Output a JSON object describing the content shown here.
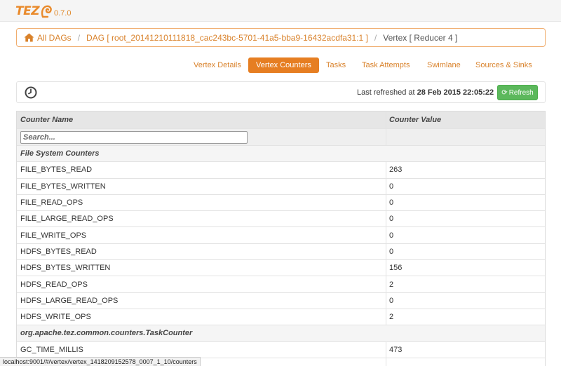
{
  "app": {
    "logo_text": "TEZ",
    "version": "0.7.0"
  },
  "breadcrumb": {
    "all_dags": "All DAGs",
    "dag": "DAG [ root_20141210111818_cac243bc-5701-41a5-bba9-16432acdfa31:1 ]",
    "current": "Vertex [ Reducer 4 ]"
  },
  "tabs": [
    {
      "label": "Vertex Details",
      "active": false
    },
    {
      "label": "Vertex Counters",
      "active": true
    },
    {
      "label": "Tasks",
      "active": false
    },
    {
      "label": "Task Attempts",
      "active": false
    },
    {
      "label": "Swimlane",
      "active": false
    },
    {
      "label": "Sources & Sinks",
      "active": false
    }
  ],
  "refresh": {
    "prefix": "Last refreshed at",
    "timestamp": "28 Feb 2015 22:05:22",
    "button_label": "Refresh"
  },
  "table": {
    "col_name": "Counter Name",
    "col_value": "Counter Value",
    "search_placeholder": "Search...",
    "groups": [
      {
        "name": "File System Counters",
        "rows": [
          {
            "name": "FILE_BYTES_READ",
            "value": "263"
          },
          {
            "name": "FILE_BYTES_WRITTEN",
            "value": "0"
          },
          {
            "name": "FILE_READ_OPS",
            "value": "0"
          },
          {
            "name": "FILE_LARGE_READ_OPS",
            "value": "0"
          },
          {
            "name": "FILE_WRITE_OPS",
            "value": "0"
          },
          {
            "name": "HDFS_BYTES_READ",
            "value": "0"
          },
          {
            "name": "HDFS_BYTES_WRITTEN",
            "value": "156"
          },
          {
            "name": "HDFS_READ_OPS",
            "value": "2"
          },
          {
            "name": "HDFS_LARGE_READ_OPS",
            "value": "0"
          },
          {
            "name": "HDFS_WRITE_OPS",
            "value": "2"
          }
        ]
      },
      {
        "name": "org.apache.tez.common.counters.TaskCounter",
        "rows": [
          {
            "name": "GC_TIME_MILLIS",
            "value": "473"
          }
        ]
      }
    ]
  },
  "status_bar": {
    "url": "localhost:9001/#/vertex/vertex_1418209152578_0007_1_10/counters"
  },
  "colors": {
    "accent": "#e67e22",
    "link": "#d9822b",
    "refresh_button": "#5cb85c"
  },
  "icons": {
    "home": "home-icon",
    "clock": "clock-icon",
    "refresh": "refresh-icon",
    "logo": "tez-logo-icon"
  }
}
